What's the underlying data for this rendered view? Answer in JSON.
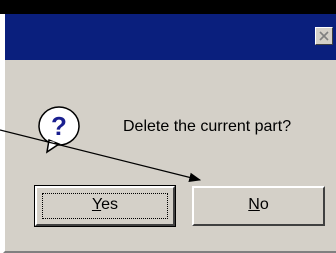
{
  "dialog": {
    "message": "Delete the current part?",
    "buttons": {
      "yes": {
        "mnemonic": "Y",
        "rest": "es"
      },
      "no": {
        "mnemonic": "N",
        "rest": "o"
      }
    }
  },
  "icons": {
    "close": "close-icon",
    "message": "question-icon"
  },
  "colors": {
    "titlebar": "#0a1f7d",
    "dialog_face": "#d4d0c8",
    "question_icon": "#1a1f8f"
  }
}
